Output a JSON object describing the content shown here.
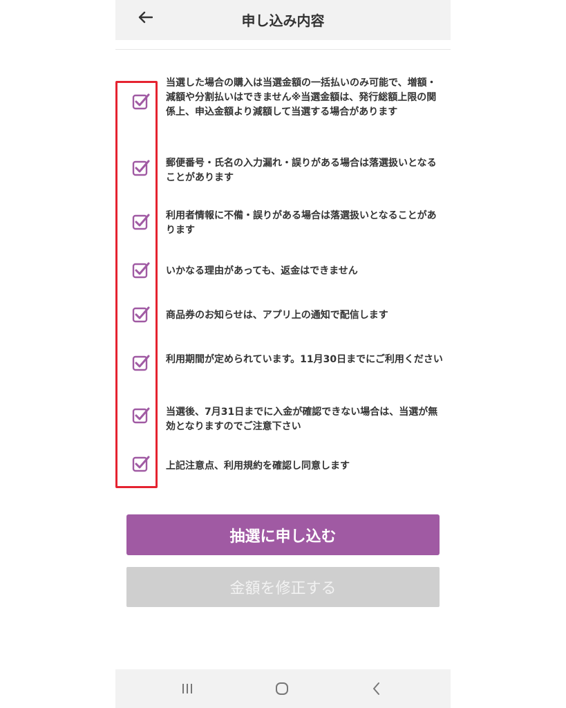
{
  "header": {
    "title": "申し込み内容",
    "back_icon": "arrow-left-icon"
  },
  "checklist": [
    {
      "checked": true,
      "text": "当選した場合の購入は当選金額の一括払いのみ可能で、増額・減額や分割払いはできません※当選金額は、発行総額上限の関係上、申込金額より減額して当選する場合があります"
    },
    {
      "checked": true,
      "text": "郵便番号・氏名の入力漏れ・誤りがある場合は落選扱いとなることがあります"
    },
    {
      "checked": true,
      "text": "利用者情報に不備・誤りがある場合は落選扱いとなることがあります"
    },
    {
      "checked": true,
      "text": "いかなる理由があっても、返金はできません"
    },
    {
      "checked": true,
      "text": "商品券のお知らせは、アプリ上の通知で配信します"
    },
    {
      "checked": true,
      "text": "利用期間が定められています。11月30日までにご利用ください"
    },
    {
      "checked": true,
      "text": "当選後、7月31日までに入金が確認できない場合は、当選が無効となりますのでご注意下さい"
    },
    {
      "checked": true,
      "text": "上記注意点、利用規約を確認し同意します"
    }
  ],
  "buttons": {
    "apply": "抽選に申し込む",
    "edit_amount": "金額を修正する"
  },
  "colors": {
    "accent": "#a05aa3",
    "highlight_border": "#e52330",
    "disabled": "#cfcfcf"
  },
  "navbar": {
    "icons": [
      "recent-apps-icon",
      "home-icon",
      "back-icon"
    ]
  }
}
